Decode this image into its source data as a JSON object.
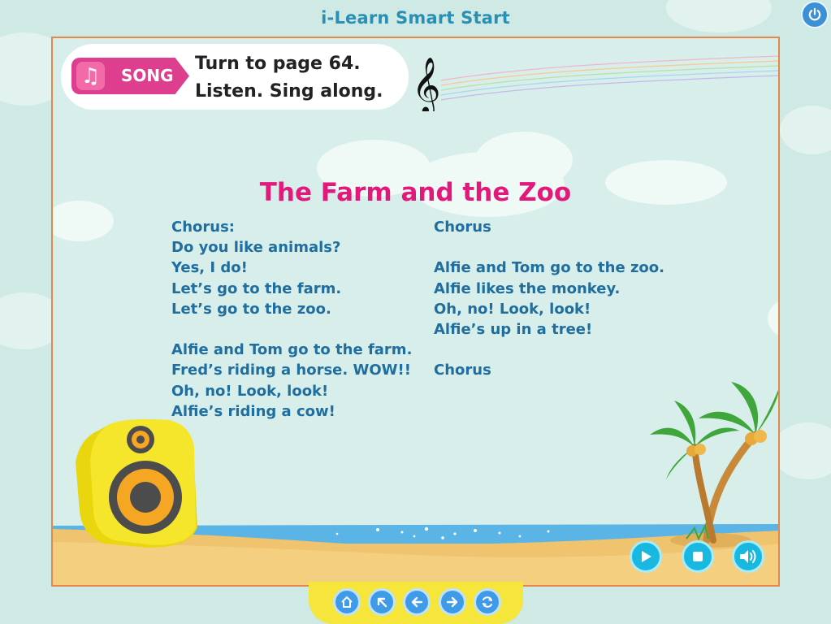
{
  "app": {
    "title": "i-Learn Smart Start"
  },
  "instruction": {
    "badge_label": "SONG",
    "badge_icon": "music-note-icon",
    "line1": "Turn to page 64.",
    "line2": "Listen. Sing along."
  },
  "song": {
    "title": "The Farm and the Zoo",
    "left_column": [
      "Chorus:",
      "Do you like animals?",
      "Yes, I do!",
      "Let’s go to the farm.",
      "Let’s go to the zoo.",
      "",
      "Alfie and Tom go to the farm.",
      "Fred’s riding a horse. WOW!!",
      "Oh, no! Look, look!",
      "Alfie’s riding a cow!"
    ],
    "right_column": [
      "Chorus",
      "",
      "Alfie and Tom go to the zoo.",
      "Alfie likes the monkey.",
      "Oh, no! Look, look!",
      "Alfie’s up in a tree!",
      "",
      "Chorus"
    ]
  },
  "controls": [
    "play-icon",
    "stop-icon",
    "volume-icon"
  ],
  "nav": [
    "home-icon",
    "back-arrow-icon",
    "previous-icon",
    "next-icon",
    "refresh-icon"
  ],
  "colors": {
    "title_pink": "#e2187a",
    "lyric_blue": "#1f6e9f",
    "frame_orange": "#e3884b",
    "app_title_blue": "#2a8fb4",
    "badge_pink": "#dd3f8e",
    "control_cyan": "#19b8e0",
    "dock_yellow": "#f6e53b"
  }
}
